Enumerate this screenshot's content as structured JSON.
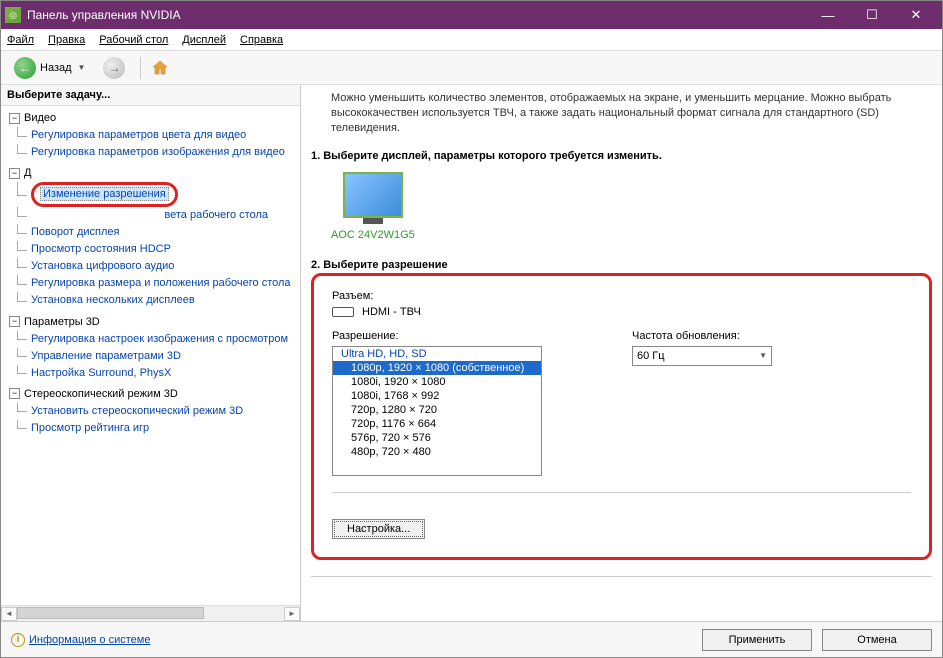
{
  "window": {
    "title": "Панель управления NVIDIA"
  },
  "menu": {
    "file": "Файл",
    "edit": "Правка",
    "desktop": "Рабочий стол",
    "display": "Дисплей",
    "help": "Справка"
  },
  "toolbar": {
    "back": "Назад"
  },
  "sidebar": {
    "header": "Выберите задачу...",
    "groups": [
      {
        "label": "Видео",
        "items": [
          "Регулировка параметров цвета для видео",
          "Регулировка параметров изображения для видео"
        ]
      },
      {
        "label": "Д",
        "highlighted_item": "Изменение разрешения",
        "tail_item": "вета рабочего стола",
        "items": [
          "Поворот дисплея",
          "Просмотр состояния HDCP",
          "Установка цифрового аудио",
          "Регулировка размера и положения рабочего стола",
          "Установка нескольких дисплеев"
        ]
      },
      {
        "label": "Параметры 3D",
        "items": [
          "Регулировка настроек изображения с просмотром",
          "Управление параметрами 3D",
          "Настройка Surround, PhysX"
        ]
      },
      {
        "label": "Стереоскопический режим 3D",
        "items": [
          "Установить стереоскопический режим 3D",
          "Просмотр рейтинга игр"
        ]
      }
    ]
  },
  "main": {
    "description": "Можно уменьшить количество элементов, отображаемых на экране, и уменьшить мерцание. Можно выбрать высококачествен используется ТВЧ, а также задать национальный формат сигнала для стандартного (SD) телевидения.",
    "section1_title": "1. Выберите дисплей, параметры которого требуется изменить.",
    "monitor_name": "AOC 24V2W1G5",
    "section2_title": "2. Выберите разрешение",
    "connector_label": "Разъем:",
    "connector_value": "HDMI - ТВЧ",
    "resolution_label": "Разрешение:",
    "refresh_label": "Частота обновления:",
    "refresh_value": "60 Гц",
    "res_header": "Ultra HD, HD, SD",
    "resolutions": [
      "1080p, 1920 × 1080 (собственное)",
      "1080i, 1920 × 1080",
      "1080i, 1768 × 992",
      "720p, 1280 × 720",
      "720p, 1176 × 664",
      "576p, 720 × 576",
      "480p, 720 × 480"
    ],
    "settings_btn": "Настройка..."
  },
  "footer": {
    "sysinfo": "Информация о системе",
    "apply": "Применить",
    "cancel": "Отмена"
  }
}
